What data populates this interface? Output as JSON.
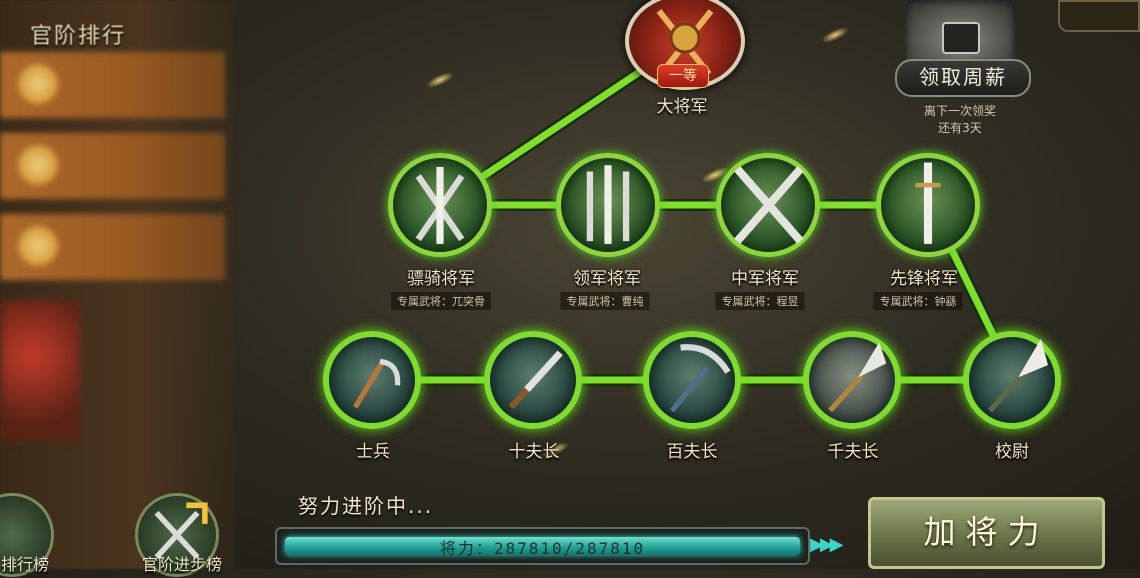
{
  "left_panel": {
    "title": "官阶排行"
  },
  "top_rank": {
    "name": "大将军",
    "badge": "一等"
  },
  "weekly": {
    "button": "领取周薪",
    "note_line1": "离下一次领奖",
    "note_line2": "还有3天"
  },
  "generals": [
    {
      "name": "骠骑将军",
      "exclusive": "专属武将：兀突骨"
    },
    {
      "name": "领军将军",
      "exclusive": "专属武将：曹纯"
    },
    {
      "name": "中军将军",
      "exclusive": "专属武将：程昱"
    },
    {
      "name": "先锋将军",
      "exclusive": "专属武将：钟繇"
    }
  ],
  "soldiers": [
    {
      "name": "士兵"
    },
    {
      "name": "十夫长"
    },
    {
      "name": "百夫长"
    },
    {
      "name": "千夫长"
    },
    {
      "name": "校尉"
    }
  ],
  "progress": {
    "status": "努力进阶中...",
    "label": "将力：287810/287810",
    "fraction": 1.0
  },
  "buttons": {
    "add_power": "加将力",
    "rank_list": "排行榜",
    "promotion_list": "官阶进步榜"
  },
  "colors": {
    "path_green": "#7fe02a",
    "bar_teal": "#2bb3a6"
  },
  "icons": {
    "scythe": "scythe-icon",
    "dagger": "dagger-icon",
    "pickaxe": "pickaxe-icon",
    "glaive": "glaive-icon",
    "chest": "treasure-chest-icon"
  }
}
